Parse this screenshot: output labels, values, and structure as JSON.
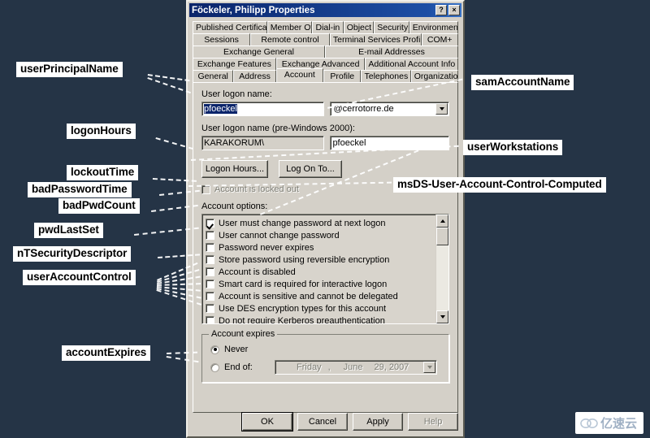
{
  "background_color": "#253446",
  "dialog": {
    "title": "Föckeler, Philipp Properties",
    "help_button": "?",
    "close_button": "×",
    "tab_rows": [
      [
        "Published Certificates",
        "Member Of",
        "Dial-in",
        "Object",
        "Security",
        "Environment"
      ],
      [
        "Sessions",
        "Remote control",
        "Terminal Services Profile",
        "COM+"
      ],
      [
        "Exchange General",
        "E-mail Addresses"
      ],
      [
        "Exchange Features",
        "Exchange Advanced",
        "Additional Account Info"
      ],
      [
        "General",
        "Address",
        "Account",
        "Profile",
        "Telephones",
        "Organization"
      ]
    ],
    "active_tab": "Account",
    "account_tab": {
      "user_logon_name_label": "User logon name:",
      "user_logon_name_value": "pfoeckel",
      "upn_suffix_value": "@cerrotorre.de",
      "pre_windows_label": "User logon name (pre-Windows 2000):",
      "domain_value": "KARAKORUM\\",
      "sam_value": "pfoeckel",
      "logon_hours_button": "Logon Hours...",
      "log_on_to_button": "Log On To...",
      "account_locked_label": "Account is locked out",
      "account_locked_checked": false,
      "account_options_label": "Account options:",
      "options": [
        {
          "label": "User must change password at next logon",
          "checked": true
        },
        {
          "label": "User cannot change password",
          "checked": false
        },
        {
          "label": "Password never expires",
          "checked": false
        },
        {
          "label": "Store password using reversible encryption",
          "checked": false
        },
        {
          "label": "Account is disabled",
          "checked": false
        },
        {
          "label": "Smart card is required for interactive logon",
          "checked": false
        },
        {
          "label": "Account is sensitive and cannot be delegated",
          "checked": false
        },
        {
          "label": "Use DES encryption types for this account",
          "checked": false
        },
        {
          "label": "Do not require Kerberos preauthentication",
          "checked": false
        }
      ],
      "account_expires_group": "Account expires",
      "never_label": "Never",
      "never_selected": true,
      "end_of_label": "End of:",
      "end_of_selected": false,
      "date_weekday": "Friday",
      "date_comma": ",",
      "date_month": "June",
      "date_day_year": "29, 2007"
    },
    "footer_buttons": [
      {
        "label": "OK",
        "disabled": false,
        "default": true
      },
      {
        "label": "Cancel",
        "disabled": false,
        "default": false
      },
      {
        "label": "Apply",
        "disabled": false,
        "default": false
      },
      {
        "label": "Help",
        "disabled": true,
        "default": false
      }
    ]
  },
  "annotations": {
    "left": [
      {
        "text": "userPrincipalName"
      },
      {
        "text": "logonHours"
      },
      {
        "text": "lockoutTime"
      },
      {
        "text": "badPasswordTime"
      },
      {
        "text": "badPwdCount"
      },
      {
        "text": "pwdLastSet"
      },
      {
        "text": "nTSecurityDescriptor"
      },
      {
        "text": "userAccountControl"
      },
      {
        "text": "accountExpires"
      }
    ],
    "right": [
      {
        "text": "samAccountName"
      },
      {
        "text": "userWorkstations"
      },
      {
        "text": "msDS-User-Account-Control-Computed"
      }
    ]
  },
  "watermark": {
    "text": "亿速云",
    "icon": "cloud-icon"
  }
}
